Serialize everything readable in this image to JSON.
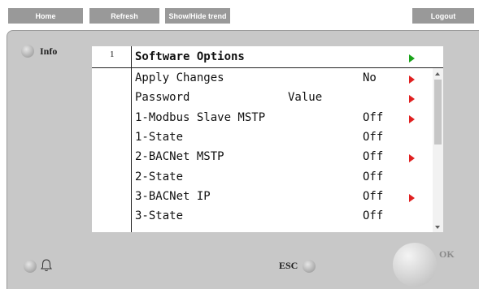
{
  "toolbar": {
    "home": "Home",
    "refresh": "Refresh",
    "trend": "Show/Hide trend",
    "logout": "Logout"
  },
  "panel": {
    "info_label": "Info",
    "esc_label": "ESC",
    "ok_label": "OK"
  },
  "screen": {
    "page_number": "1",
    "title": "Software Options",
    "rows": [
      {
        "label": "Apply Changes",
        "mid": "",
        "value": "No",
        "arrow": "red"
      },
      {
        "label": "Password",
        "mid": "Value",
        "value": "",
        "arrow": "red"
      },
      {
        "label": "1-Modbus Slave MSTP",
        "mid": "",
        "value": "Off",
        "arrow": "red"
      },
      {
        "label": "1-State",
        "mid": "",
        "value": "Off",
        "arrow": ""
      },
      {
        "label": "2-BACNet MSTP",
        "mid": "",
        "value": "Off",
        "arrow": "red"
      },
      {
        "label": "2-State",
        "mid": "",
        "value": "Off",
        "arrow": ""
      },
      {
        "label": "3-BACNet IP",
        "mid": "",
        "value": "Off",
        "arrow": "red"
      },
      {
        "label": "3-State",
        "mid": "",
        "value": "Off",
        "arrow": ""
      }
    ]
  },
  "colors": {
    "button_bg": "#999999",
    "panel_bg": "#c8c8c8",
    "arrow_red": "#e02020",
    "arrow_green": "#1aa31a"
  }
}
